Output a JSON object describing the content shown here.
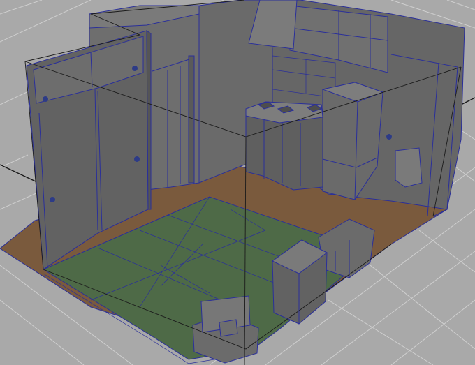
{
  "viewport": {
    "view": "perspective",
    "display_mode": "shaded-with-wireframe"
  },
  "colors": {
    "background": "#a9a9a9",
    "grid": "#cfcfcf",
    "grid_axis": "#1a1a1a",
    "wall": "#6b6b6b",
    "wall_dark": "#5a5a5a",
    "wall_light": "#7a7a7a",
    "tatami": "#4e6a47",
    "wood_floor": "#7a5a3d",
    "wireframe": "#2a2f9a",
    "selection": "#1b1b1b"
  },
  "scene_objects": [
    "room-walls",
    "closet-sliding-doors",
    "tatami-floor",
    "wood-floor",
    "kitchen-counter",
    "stove-burners",
    "range-hood",
    "upper-cabinets",
    "refrigerator",
    "wall-mounted-box",
    "low-cabinet-tall",
    "low-cabinet-short",
    "tv-on-stand",
    "door-frame"
  ]
}
